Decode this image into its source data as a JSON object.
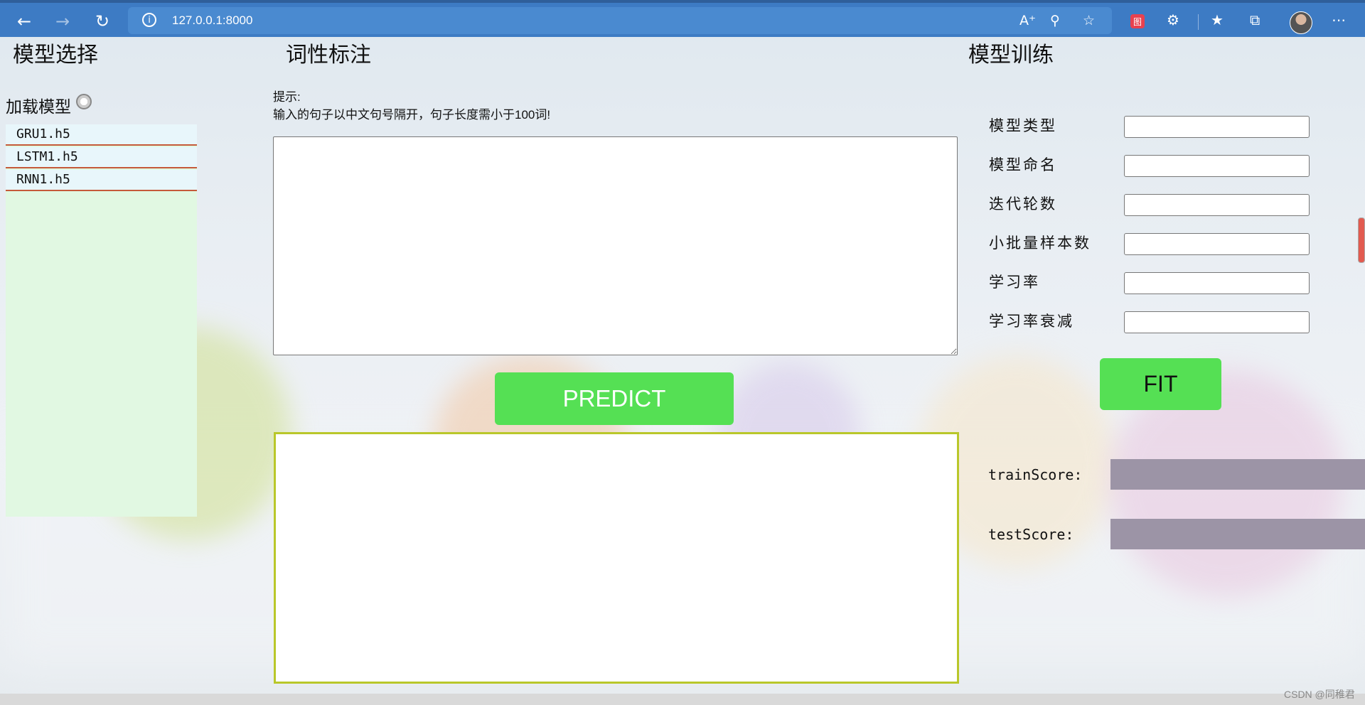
{
  "browser": {
    "url": "127.0.0.1:8000",
    "ext_badge": "图"
  },
  "model_select": {
    "title": "模型选择",
    "load_label": "加载模型",
    "models": [
      "GRU1.h5",
      "LSTM1.h5",
      "RNN1.h5"
    ]
  },
  "pos_tagging": {
    "title": "词性标注",
    "hint_title": "提示:",
    "hint_text": "输入的句子以中文句号隔开，句子长度需小于100词!",
    "input_value": "",
    "predict_label": "PREDICT",
    "output_value": ""
  },
  "training": {
    "title": "模型训练",
    "fields": [
      {
        "label": "模型类型",
        "value": ""
      },
      {
        "label": "模型命名",
        "value": ""
      },
      {
        "label": "迭代轮数",
        "value": ""
      },
      {
        "label": "小批量样本数",
        "value": ""
      },
      {
        "label": "学习率",
        "value": ""
      },
      {
        "label": "学习率衰减",
        "value": ""
      }
    ],
    "fit_label": "FIT",
    "train_score_label": "trainScore:",
    "test_score_label": "testScore:",
    "train_score_value": "",
    "test_score_value": ""
  },
  "watermark": "CSDN @同稚君",
  "colors": {
    "toolbar": "#3d7bc4",
    "button_green": "#55e054",
    "list_bg": "#e1f8e2",
    "score_box": "#9c94a6",
    "output_border": "#b9c72a"
  }
}
